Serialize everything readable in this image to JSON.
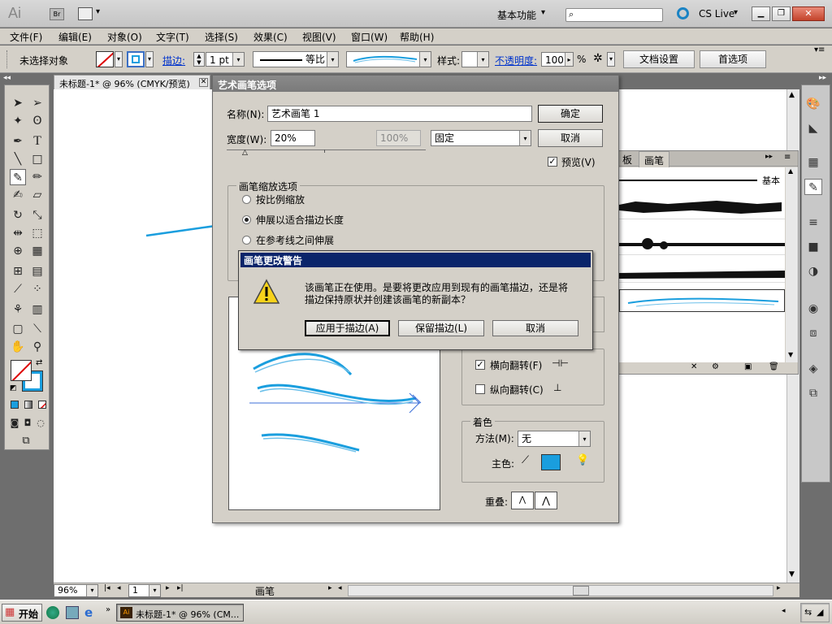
{
  "app": {
    "logo": "Ai",
    "bridge_label": "Br",
    "workspace_label": "基本功能",
    "cs_live_label": "CS Live"
  },
  "menu": {
    "items": [
      "文件(F)",
      "编辑(E)",
      "对象(O)",
      "文字(T)",
      "选择(S)",
      "效果(C)",
      "视图(V)",
      "窗口(W)",
      "帮助(H)"
    ]
  },
  "control_bar": {
    "selection_status": "未选择对象",
    "stroke_label": "描边:",
    "stroke_weight": "1 pt",
    "profile_value": "等比",
    "style_label": "样式:",
    "opacity_label": "不透明度:",
    "opacity_value": "100",
    "opacity_unit": "%",
    "doc_setup_button": "文档设置",
    "preferences_button": "首选项"
  },
  "document": {
    "tab_title": "未标题-1* @ 96% (CMYK/预览)",
    "zoom_value": "96%",
    "page_value": "1",
    "status_text": "画笔"
  },
  "art_brush_dialog": {
    "title": "艺术画笔选项",
    "name_label": "名称(N):",
    "name_value": "艺术画笔 1",
    "ok_button": "确定",
    "cancel_button": "取消",
    "width_label": "宽度(W):",
    "width_value": "20%",
    "width_max_value": "100%",
    "width_mode_value": "固定",
    "preview_label": "预览(V)",
    "scale_group_title": "画笔缩放选项",
    "scale_options": [
      "按比例缩放",
      "伸展以适合描边长度",
      "在参考线之间伸展"
    ],
    "scale_selected": 1,
    "flip_h_label": "横向翻转(F)",
    "flip_v_label": "纵向翻转(C)",
    "colorization_group_title": "着色",
    "method_label": "方法(M):",
    "method_value": "无",
    "key_color_label": "主色:",
    "key_color": "#1a9ede",
    "overlap_label": "重叠:"
  },
  "brush_panel": {
    "tab_partial": "板",
    "tab_active": "画笔",
    "basic_label": "基本"
  },
  "warning_dialog": {
    "title": "画笔更改警告",
    "message_line1": "该画笔正在使用。是要将更改应用到现有的画笔描边，还是将",
    "message_line2": "描边保持原状并创建该画笔的新副本？",
    "apply_button": "应用于描边(A)",
    "keep_button": "保留描边(L)",
    "cancel_button": "取消"
  },
  "taskbar": {
    "start_label": "开始",
    "task_label": "未标题-1* @ 96% (CM..."
  },
  "colors": {
    "brush_blue": "#1a9ede",
    "dialog_title_bg": "#0a246a",
    "dialog_bg": "#d4d0c8"
  }
}
